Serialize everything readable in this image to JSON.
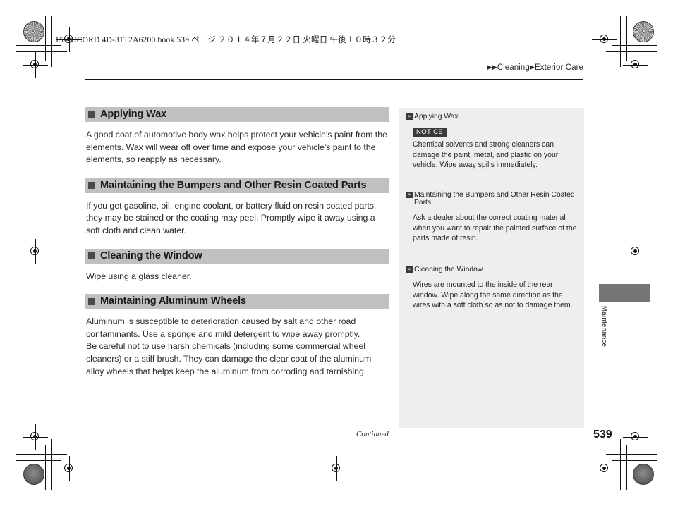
{
  "print_header": {
    "code": "15 ACCORD 4D-31T2A6200.book   539 ページ   ２０１４年７月２２日   火曜日   午後１０時３２分"
  },
  "breadcrumb": {
    "arrow_double": "▶▶",
    "arrow_single": "▶",
    "level1": "Cleaning",
    "level2": "Exterior Care"
  },
  "main": {
    "sections": [
      {
        "heading": "Applying Wax",
        "body": "A good coat of automotive body wax helps protect your vehicle's paint from the elements. Wax will wear off over time and expose your vehicle's paint to the elements, so reapply as necessary."
      },
      {
        "heading": "Maintaining the Bumpers and Other Resin Coated Parts",
        "body": "If you get gasoline, oil, engine coolant, or battery fluid on resin coated parts, they may be stained or the coating may peel. Promptly wipe it away using a soft cloth and clean water."
      },
      {
        "heading": "Cleaning the Window",
        "body": "Wipe using a glass cleaner."
      },
      {
        "heading": "Maintaining Aluminum Wheels",
        "body1": "Aluminum is susceptible to deterioration caused by salt and other road contaminants. Use a sponge and mild detergent to wipe away promptly.",
        "body2": "Be careful not to use harsh chemicals (including some commercial wheel cleaners) or a stiff brush. They can damage the clear coat of the aluminum alloy wheels that helps keep the aluminum from corroding and tarnishing."
      }
    ]
  },
  "side_panel": {
    "marker_glyph": "»",
    "sections": [
      {
        "heading": "Applying Wax",
        "notice_label": "NOTICE",
        "body": "Chemical solvents and strong cleaners can damage the paint, metal, and plastic on your vehicle. Wipe away spills immediately."
      },
      {
        "heading": "Maintaining the Bumpers and Other Resin Coated Parts",
        "body": "Ask a dealer about the correct coating material when you want to repair the painted surface of the parts made of resin."
      },
      {
        "heading": "Cleaning the Window",
        "body": "Wires are mounted to the inside of the rear window. Wipe along the same direction as the wires with a soft cloth so as not to damage them."
      }
    ]
  },
  "footer": {
    "continued": "Continued",
    "page_number": "539"
  },
  "thumb_tab": {
    "label": "Maintenance"
  },
  "colors": {
    "heading_bar": "#c0c0c0",
    "side_panel_bg": "#eeeeee",
    "notice_bg": "#3a3a3a",
    "thumb_tab": "#757575"
  }
}
